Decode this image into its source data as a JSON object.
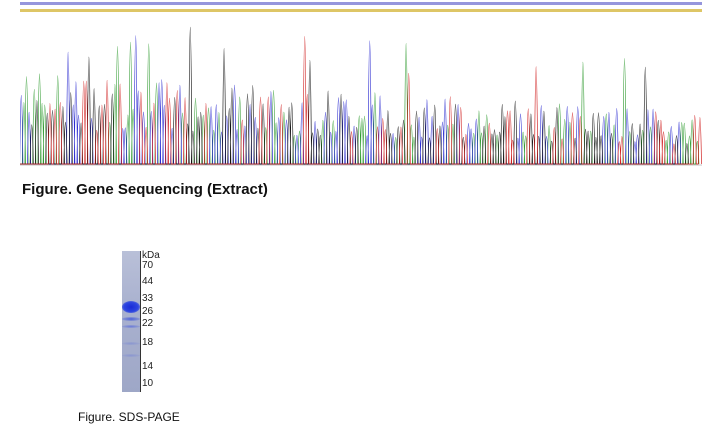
{
  "sequencing_figure": {
    "title": "Figure. Gene Sequencing (Extract)",
    "base_colors": {
      "A": "#2e9a2e",
      "C": "#2a2ad0",
      "G": "#111111",
      "T": "#d02020"
    },
    "sequence_color": "#4040c0",
    "translation_color": "#c8a000"
  },
  "sds_page_figure": {
    "caption": "Figure. SDS-PAGE",
    "unit_label": "kDa",
    "markers": [
      "70",
      "44",
      "33",
      "26",
      "22",
      "18",
      "14",
      "10"
    ],
    "band_color": "#2030d8"
  }
}
